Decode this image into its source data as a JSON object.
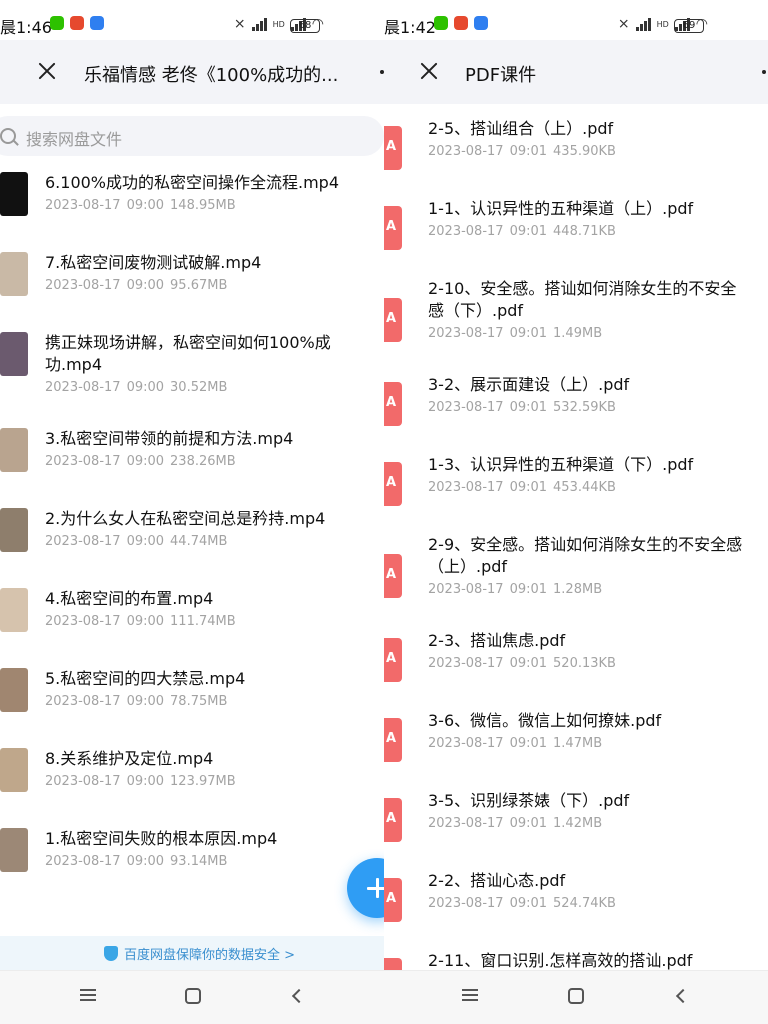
{
  "left": {
    "status": {
      "time": "晨1:46",
      "battery": "68",
      "net_label": "HD"
    },
    "title": "乐福情感 老佟《100%成功的...",
    "search_placeholder": "搜索网盘文件",
    "files": [
      {
        "name": "6.100%成功的私密空间操作全流程.mp4",
        "date": "2023-08-17",
        "time": "09:00",
        "size": "148.95MB"
      },
      {
        "name": "7.私密空间废物测试破解.mp4",
        "date": "2023-08-17",
        "time": "09:00",
        "size": "95.67MB"
      },
      {
        "name": "携正妹现场讲解，私密空间如何100%成功.mp4",
        "date": "2023-08-17",
        "time": "09:00",
        "size": "30.52MB"
      },
      {
        "name": "3.私密空间带领的前提和方法.mp4",
        "date": "2023-08-17",
        "time": "09:00",
        "size": "238.26MB"
      },
      {
        "name": "2.为什么女人在私密空间总是矜持.mp4",
        "date": "2023-08-17",
        "time": "09:00",
        "size": "44.74MB"
      },
      {
        "name": "4.私密空间的布置.mp4",
        "date": "2023-08-17",
        "time": "09:00",
        "size": "111.74MB"
      },
      {
        "name": "5.私密空间的四大禁忌.mp4",
        "date": "2023-08-17",
        "time": "09:00",
        "size": "78.75MB"
      },
      {
        "name": "8.关系维护及定位.mp4",
        "date": "2023-08-17",
        "time": "09:00",
        "size": "123.97MB"
      },
      {
        "name": "1.私密空间失败的根本原因.mp4",
        "date": "2023-08-17",
        "time": "09:00",
        "size": "93.14MB"
      }
    ],
    "safety_banner": "百度网盘保障你的数据安全 >"
  },
  "right": {
    "status": {
      "time": "晨1:42",
      "battery": "69",
      "net_label": "HD"
    },
    "title": "PDF课件",
    "files": [
      {
        "name": "2-5、搭讪组合（上）.pdf",
        "date": "2023-08-17",
        "time": "09:01",
        "size": "435.90KB"
      },
      {
        "name": "1-1、认识异性的五种渠道（上）.pdf",
        "date": "2023-08-17",
        "time": "09:01",
        "size": "448.71KB"
      },
      {
        "name": "2-10、安全感。搭讪如何消除女生的不安全感（下）.pdf",
        "date": "2023-08-17",
        "time": "09:01",
        "size": "1.49MB"
      },
      {
        "name": "3-2、展示面建设（上）.pdf",
        "date": "2023-08-17",
        "time": "09:01",
        "size": "532.59KB"
      },
      {
        "name": "1-3、认识异性的五种渠道（下）.pdf",
        "date": "2023-08-17",
        "time": "09:01",
        "size": "453.44KB"
      },
      {
        "name": "2-9、安全感。搭讪如何消除女生的不安全感（上）.pdf",
        "date": "2023-08-17",
        "time": "09:01",
        "size": "1.28MB"
      },
      {
        "name": "2-3、搭讪焦虑.pdf",
        "date": "2023-08-17",
        "time": "09:01",
        "size": "520.13KB"
      },
      {
        "name": "3-6、微信。微信上如何撩妹.pdf",
        "date": "2023-08-17",
        "time": "09:01",
        "size": "1.47MB"
      },
      {
        "name": "3-5、识别绿茶婊（下）.pdf",
        "date": "2023-08-17",
        "time": "09:01",
        "size": "1.42MB"
      },
      {
        "name": "2-2、搭讪心态.pdf",
        "date": "2023-08-17",
        "time": "09:01",
        "size": "524.74KB"
      },
      {
        "name": "2-11、窗口识别.怎样高效的搭讪.pdf",
        "date": "",
        "time": "",
        "size": ""
      }
    ]
  },
  "colors": {
    "accent": "#2f9df4",
    "pdf_red": "#f26a6a",
    "meta_gray": "#a3a3a3",
    "appbar_bg": "#f3f4f8"
  }
}
